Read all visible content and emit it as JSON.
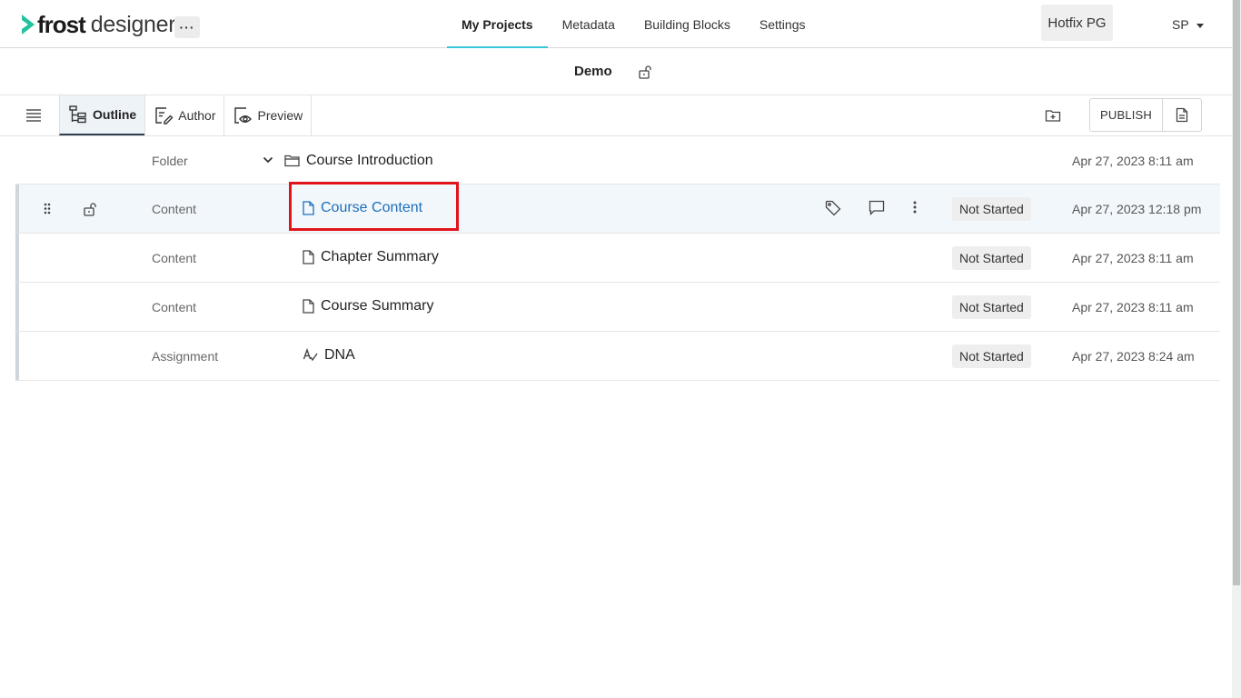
{
  "brand": {
    "name_bold": "frost",
    "name_light": "designer",
    "accent": "#21c2a1"
  },
  "header": {
    "more_label": "···",
    "nav": [
      {
        "label": "My Projects",
        "active": true
      },
      {
        "label": "Metadata",
        "active": false
      },
      {
        "label": "Building Blocks",
        "active": false
      },
      {
        "label": "Settings",
        "active": false
      }
    ],
    "environment": "Hotfix PG",
    "user_initials": "SP"
  },
  "project": {
    "title": "Demo",
    "lock_icon": "unlock-icon"
  },
  "toolbar": {
    "tabs": [
      {
        "label": "Outline",
        "icon": "outline-tree-icon",
        "active": true
      },
      {
        "label": "Author",
        "icon": "author-edit-icon",
        "active": false
      },
      {
        "label": "Preview",
        "icon": "preview-eye-icon",
        "active": false
      }
    ],
    "publish_label": "PUBLISH"
  },
  "outline": {
    "folder": {
      "type": "Folder",
      "name": "Course Introduction",
      "date": "Apr 27, 2023 8:11 am"
    },
    "items": [
      {
        "type": "Content",
        "name": "Course Content",
        "status": "Not Started",
        "date": "Apr 27, 2023 12:18 pm",
        "selected": true
      },
      {
        "type": "Content",
        "name": "Chapter Summary",
        "status": "Not Started",
        "date": "Apr 27, 2023 8:11 am",
        "selected": false
      },
      {
        "type": "Content",
        "name": "Course Summary",
        "status": "Not Started",
        "date": "Apr 27, 2023 8:11 am",
        "selected": false
      },
      {
        "type": "Assignment",
        "name": "DNA",
        "status": "Not Started",
        "date": "Apr 27, 2023 8:24 am",
        "selected": false
      }
    ]
  },
  "colors": {
    "active_tab_underline": "#37c6d8",
    "link": "#1e6fb8",
    "highlight": "#e0141b"
  }
}
